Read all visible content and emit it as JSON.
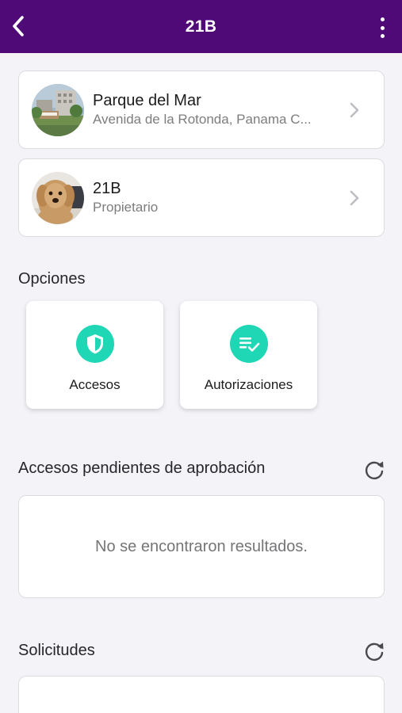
{
  "header": {
    "title": "21B",
    "bg_color": "#4f0a78",
    "back_icon": "chevron-left-icon",
    "menu_icon": "more-vertical-icon"
  },
  "property": {
    "name": "Parque del Mar",
    "address": "Avenida de la Rotonda, Panama C..."
  },
  "unit": {
    "name": "21B",
    "role": "Propietario"
  },
  "options": {
    "title": "Opciones",
    "items": [
      {
        "label": "Accesos",
        "icon": "shield-icon"
      },
      {
        "label": "Autorizaciones",
        "icon": "checklist-icon"
      }
    ],
    "accent_color": "#1fd6b5"
  },
  "pending": {
    "title": "Accesos pendientes de aprobación",
    "empty_text": "No se encontraron resultados.",
    "refresh_icon": "refresh-icon"
  },
  "requests": {
    "title": "Solicitudes",
    "refresh_icon": "refresh-icon"
  }
}
